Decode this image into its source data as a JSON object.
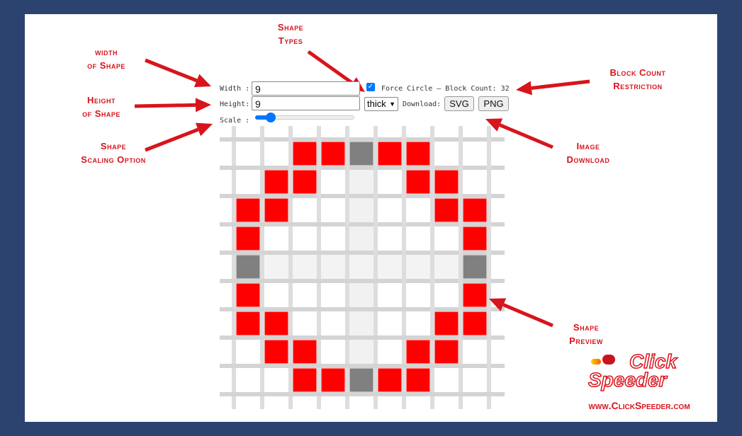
{
  "controls": {
    "width_label": "Width :",
    "width_value": "9",
    "height_label": "Height:",
    "height_value": "9",
    "scale_label": "Scale :",
    "scale_level_percent": 12,
    "force_circle_checked": true,
    "force_circle_label": "Force Circle — Block Count: 32",
    "shape_type_selected": "thick",
    "download_label": "Download:",
    "svg_button": "SVG",
    "png_button": "PNG"
  },
  "preview": {
    "columns": 9,
    "rows": 9,
    "filled_color": "#ff0000",
    "center_color": "#808080",
    "cells": [
      [
        0,
        0,
        1,
        1,
        2,
        1,
        1,
        0,
        0
      ],
      [
        0,
        1,
        1,
        0,
        0,
        0,
        1,
        1,
        0
      ],
      [
        1,
        1,
        0,
        0,
        0,
        0,
        0,
        1,
        1
      ],
      [
        1,
        0,
        0,
        0,
        0,
        0,
        0,
        0,
        1
      ],
      [
        2,
        0,
        0,
        0,
        0,
        0,
        0,
        0,
        2
      ],
      [
        1,
        0,
        0,
        0,
        0,
        0,
        0,
        0,
        1
      ],
      [
        1,
        1,
        0,
        0,
        0,
        0,
        0,
        1,
        1
      ],
      [
        0,
        1,
        1,
        0,
        0,
        0,
        1,
        1,
        0
      ],
      [
        0,
        0,
        1,
        1,
        2,
        1,
        1,
        0,
        0
      ]
    ]
  },
  "annotations": {
    "width": [
      "width",
      "of Shape"
    ],
    "height": [
      "Height",
      "of Shape"
    ],
    "scale": [
      "Shape",
      "Scaling Option"
    ],
    "types": [
      "Shape",
      "Types"
    ],
    "block_count": [
      "Block Count",
      "Restriction"
    ],
    "download": [
      "Image",
      "Download"
    ],
    "preview": [
      "Shape",
      "Preview"
    ]
  },
  "branding": {
    "logo_line1": "Click",
    "logo_line2": "Speeder",
    "url": "www.ClickSpeeder.com"
  },
  "colors": {
    "frame": "#2c4370",
    "annotation": "#d8141c",
    "accent": "#0075ff"
  }
}
